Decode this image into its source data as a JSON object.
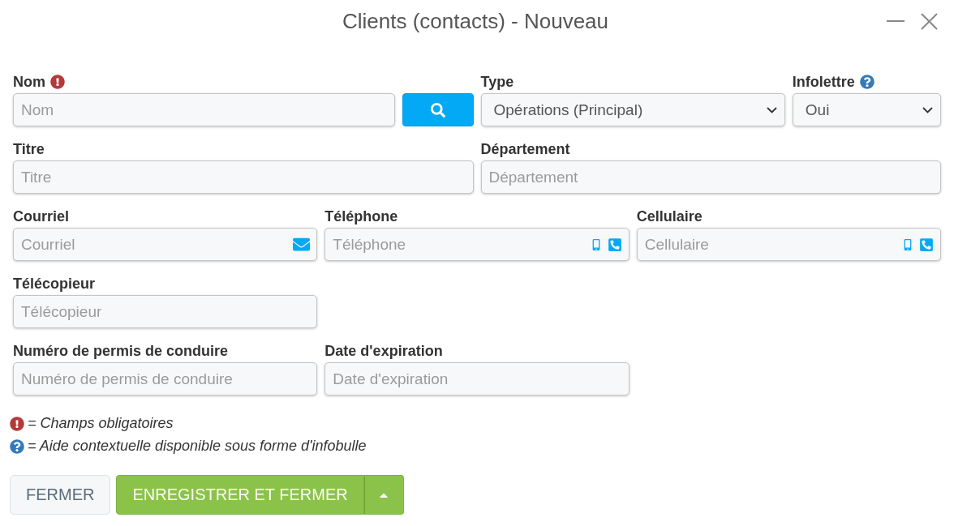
{
  "window": {
    "title": "Clients (contacts) - Nouveau"
  },
  "form": {
    "rows": [
      {
        "fields": [
          {
            "kind": "text",
            "label": "Nom",
            "required": true,
            "help": false,
            "placeholder": "Nom"
          },
          {
            "kind": "search"
          },
          {
            "kind": "select",
            "label": "Type",
            "required": false,
            "help": false,
            "value": "Opérations (Principal)"
          },
          {
            "kind": "select",
            "label": "Infolettre",
            "required": false,
            "help": true,
            "value": "Oui"
          }
        ]
      },
      {
        "fields": [
          {
            "kind": "text",
            "label": "Titre",
            "required": false,
            "help": false,
            "placeholder": "Titre"
          },
          {
            "kind": "text",
            "label": "Département",
            "required": false,
            "help": false,
            "placeholder": "Département"
          }
        ]
      },
      {
        "fields": [
          {
            "kind": "email",
            "label": "Courriel",
            "required": false,
            "help": false,
            "placeholder": "Courriel"
          },
          {
            "kind": "phone",
            "label": "Téléphone",
            "required": false,
            "help": false,
            "placeholder": "Téléphone"
          },
          {
            "kind": "phone",
            "label": "Cellulaire",
            "required": false,
            "help": false,
            "placeholder": "Cellulaire"
          }
        ]
      },
      {
        "fields": [
          {
            "kind": "text",
            "label": "Télécopieur",
            "required": false,
            "help": false,
            "placeholder": "Télécopieur"
          }
        ]
      },
      {
        "fields": [
          {
            "kind": "text",
            "label": "Numéro de permis de conduire",
            "required": false,
            "help": false,
            "placeholder": "Numéro de permis de conduire"
          },
          {
            "kind": "text",
            "label": "Date d'expiration",
            "required": false,
            "help": false,
            "placeholder": "Date d'expiration"
          }
        ]
      }
    ]
  },
  "legend": [
    {
      "kind": "required",
      "text": "= Champs obligatoires"
    },
    {
      "kind": "help",
      "text": "= Aide contextuelle disponible sous forme d'infobulle"
    }
  ],
  "buttons": [
    {
      "kind": "secondary",
      "label": "FERMER"
    },
    {
      "kind": "primary",
      "label": "ENREGISTRER ET FERMER"
    },
    {
      "kind": "dropdown"
    }
  ]
}
